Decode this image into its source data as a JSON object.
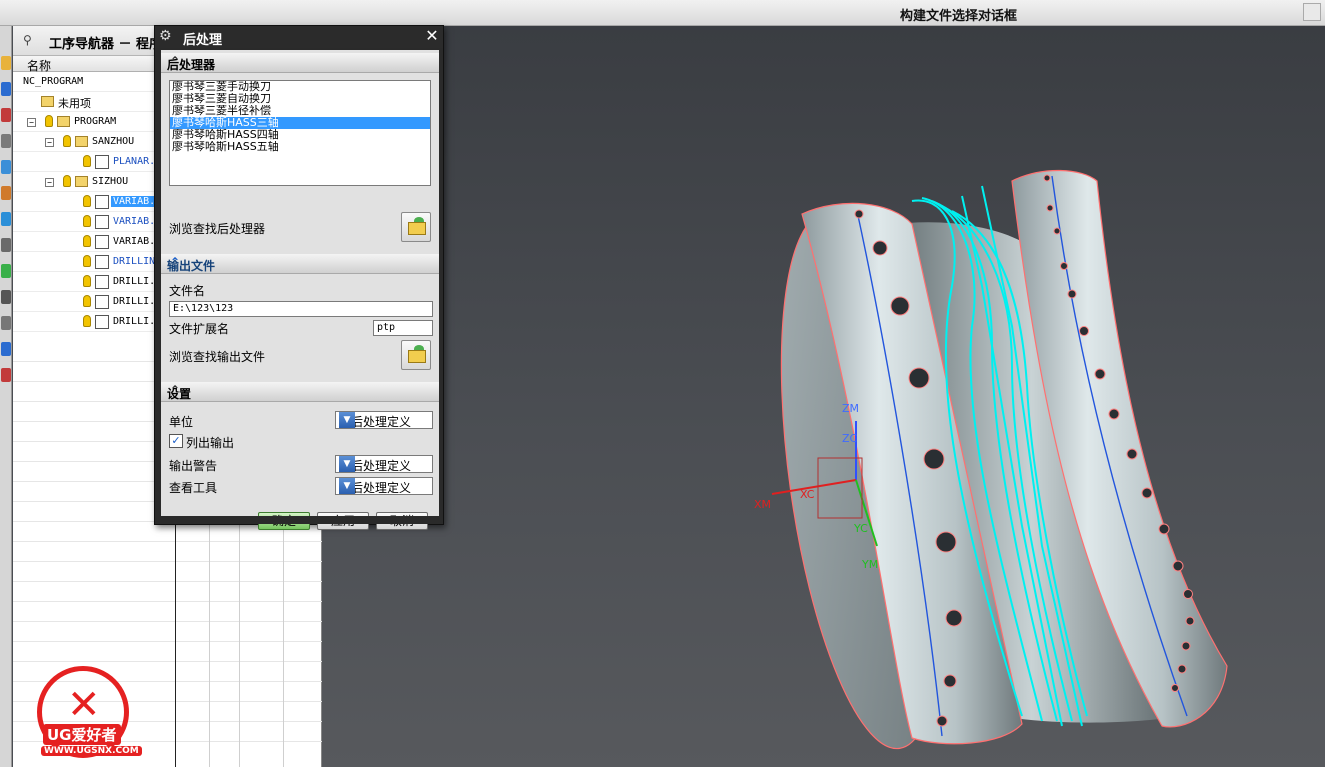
{
  "topbar": {
    "title": "构建文件选择对话框"
  },
  "navigator": {
    "title": "工序导航器 － 程序",
    "column_header": "名称",
    "rows": [
      {
        "label": "NC_PROGRAM"
      },
      {
        "label": "未用项"
      },
      {
        "label": "PROGRAM"
      },
      {
        "label": "SANZHOU"
      },
      {
        "label": "PLANAR."
      },
      {
        "label": "SIZHOU"
      },
      {
        "label": "VARIAB."
      },
      {
        "label": "VARIAB."
      },
      {
        "label": "VARIAB."
      },
      {
        "label": "DRILLIN"
      },
      {
        "label": "DRILLI."
      },
      {
        "label": "DRILLI."
      },
      {
        "label": "DRILLI."
      }
    ]
  },
  "logo": {
    "brand": "UG爱好者",
    "url": "WWW.UGSNX.COM"
  },
  "dialog": {
    "title": "后处理",
    "postprocessor_section": "后处理器",
    "postprocessors": [
      "廖书琴三菱手动换刀",
      "廖书琴三菱自动换刀",
      "廖书琴三菱半径补偿",
      "廖书琴哈斯HASS三轴",
      "廖书琴哈斯HASS四轴",
      "廖书琴哈斯HASS五轴"
    ],
    "selected_index": 3,
    "browse_post_label": "浏览查找后处理器",
    "output_section": "输出文件",
    "filename_label": "文件名",
    "filename_value": "E:\\123\\123",
    "ext_label": "文件扩展名",
    "ext_value": "ptp",
    "browse_output_label": "浏览查找输出文件",
    "settings_section": "设置",
    "units_label": "单位",
    "units_value": "经后处理定义",
    "list_output_label": "列出输出",
    "list_output_checked": true,
    "warnings_label": "输出警告",
    "warnings_value": "经后处理定义",
    "review_label": "查看工具",
    "review_value": "经后处理定义",
    "ok_label": "确定",
    "apply_label": "应用",
    "cancel_label": "取消"
  },
  "viewport": {
    "axis_labels": {
      "zm": "ZM",
      "zc": "ZC",
      "xm": "XM",
      "xc": "XC",
      "yc": "YC",
      "ym": "YM"
    }
  }
}
